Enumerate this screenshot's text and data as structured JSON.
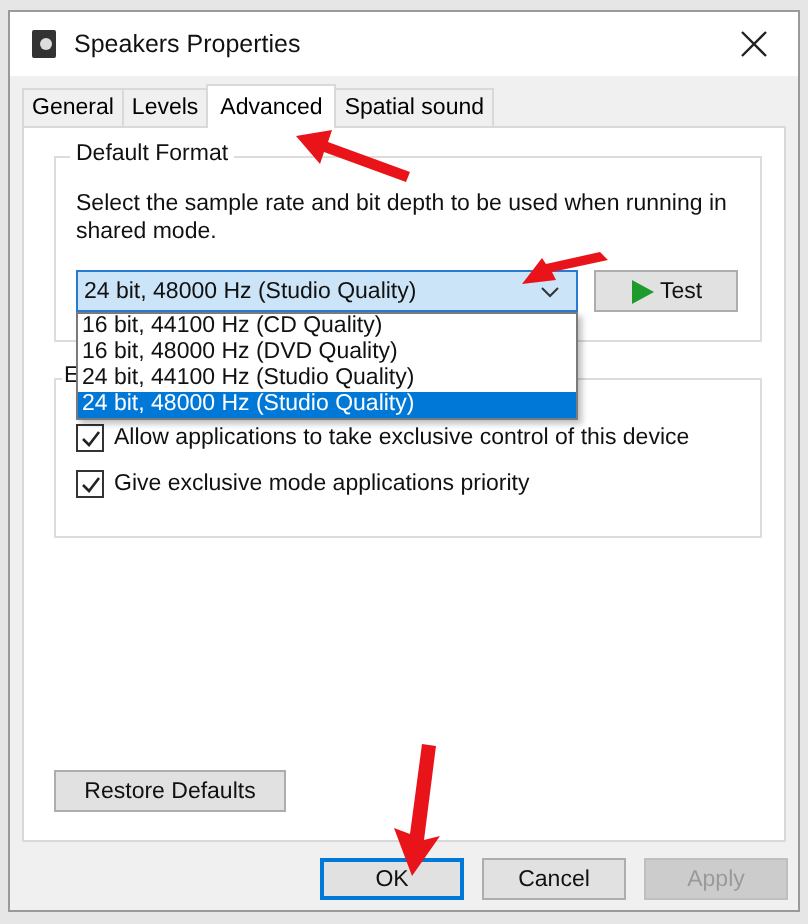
{
  "window": {
    "title": "Speakers Properties"
  },
  "tabs": [
    {
      "label": "General",
      "selected": false
    },
    {
      "label": "Levels",
      "selected": false
    },
    {
      "label": "Advanced",
      "selected": true
    },
    {
      "label": "Spatial sound",
      "selected": false
    }
  ],
  "default_format": {
    "title": "Default Format",
    "description": "Select the sample rate and bit depth to be used when running in shared mode.",
    "value": "24 bit, 48000 Hz (Studio Quality)",
    "test_button": "Test",
    "options": [
      {
        "label": "16 bit, 44100 Hz (CD Quality)",
        "selected": false
      },
      {
        "label": "16 bit, 48000 Hz (DVD Quality)",
        "selected": false
      },
      {
        "label": "24 bit, 44100 Hz (Studio Quality)",
        "selected": false
      },
      {
        "label": "24 bit, 48000 Hz (Studio Quality)",
        "selected": true
      }
    ]
  },
  "exclusive_mode": {
    "title": "E",
    "options": [
      {
        "label": "Allow applications to take exclusive control of this device",
        "checked": true
      },
      {
        "label": "Give exclusive mode applications priority",
        "checked": true
      }
    ]
  },
  "restore_button": "Restore Defaults",
  "buttons": [
    {
      "label": "OK",
      "disabled": false,
      "focused": true
    },
    {
      "label": "Cancel",
      "disabled": false,
      "focused": false
    },
    {
      "label": "Apply",
      "disabled": true,
      "focused": false
    }
  ]
}
